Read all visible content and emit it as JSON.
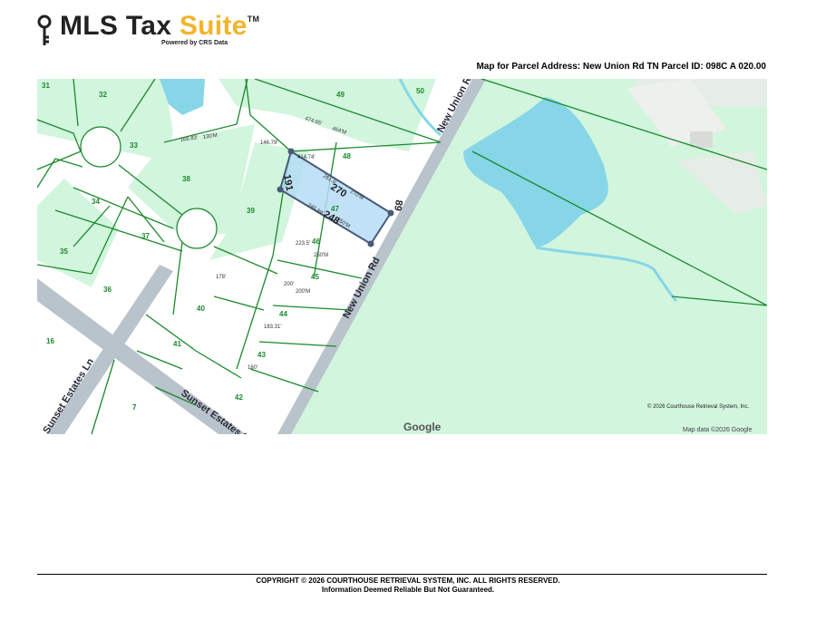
{
  "brand": {
    "name_part1": "MLS Tax ",
    "name_part2": "Suite",
    "trademark": "TM",
    "powered_by": "Powered by CRS Data",
    "accent_color": "#f3b32b"
  },
  "map_title": "Map for Parcel Address: New Union Rd TN Parcel ID: 098C A 020.00",
  "map": {
    "streets": [
      "New Union Rd",
      "Sunset Estates Dr",
      "Sunset Estates Ln"
    ],
    "parcel_numbers": [
      "31",
      "32",
      "33",
      "38",
      "39",
      "40",
      "41",
      "42",
      "43",
      "44",
      "45",
      "46",
      "47",
      "48",
      "49",
      "50",
      "34",
      "35",
      "36",
      "37",
      "16",
      "7"
    ],
    "dimensions": {
      "subject_top_left": "191",
      "subject_top": "270",
      "subject_bottom": "248",
      "subject_right": "89",
      "subject_top_sub": "261.9'",
      "subject_top_deg": "270'M",
      "subject_bottom_sub": "245.89'",
      "subject_bottom_deg": "250'M",
      "d48_top": "414.74'",
      "d49_a": "474.65'",
      "d49_b": "464'M",
      "d38_a": "166.83'",
      "d38_b": "130'M",
      "d39_top": "146.79'",
      "d46": "223.5'",
      "d46_b": "250'M",
      "d45": "200'",
      "d45_b": "200'M",
      "d44": "183.31'",
      "d43": "160'",
      "d_lot_a": "178'"
    },
    "copyright_inset": "© 2026 Courthouse Retrieval System, Inc.",
    "google_logo": "Google",
    "map_data": "Map data ©2026 Google",
    "water_color": "#86d6e8",
    "greenspace_color": "#d2f5dd",
    "parcel_line_color": "#1a8a2c",
    "road_color": "#b9c3cb",
    "subject_fill": "#b5dcf4",
    "subject_stroke": "#4a5a78"
  },
  "footer": {
    "copyright": "COPYRIGHT © 2026 COURTHOUSE RETRIEVAL SYSTEM, INC. ALL RIGHTS RESERVED.",
    "disclaimer": "Information Deemed Reliable But Not Guaranteed."
  }
}
